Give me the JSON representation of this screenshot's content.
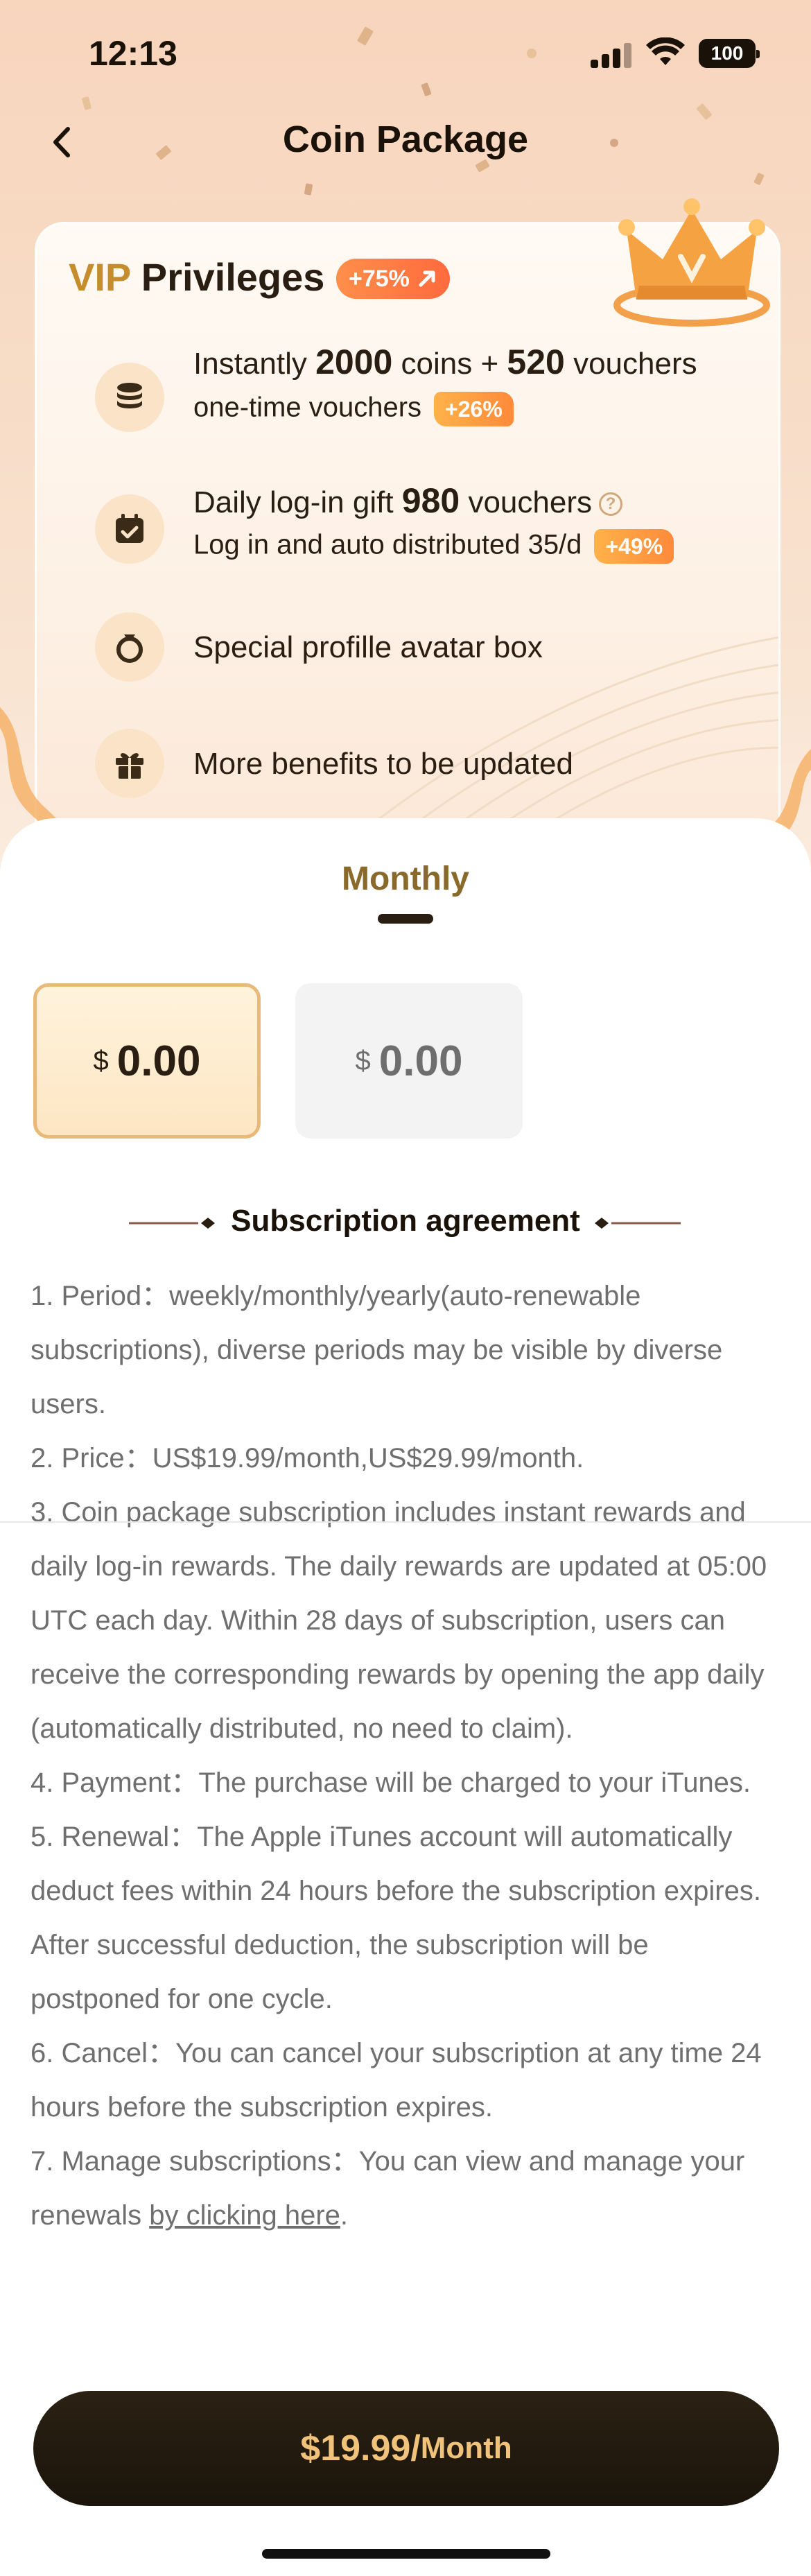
{
  "status_bar": {
    "time": "12:13",
    "battery": "100"
  },
  "header": {
    "title": "Coin Package"
  },
  "vip": {
    "title_prefix": "VIP",
    "title_rest": " Privileges",
    "badge": "+75%",
    "benefits": [
      {
        "line1_pre": "Instantly ",
        "line1_b1": "2000",
        "line1_mid": " coins + ",
        "line1_b2": "520",
        "line1_post": " vouchers",
        "line2": "one-time vouchers",
        "tag": "+26%"
      },
      {
        "line1_pre": "Daily log-in gift ",
        "line1_b1": "980",
        "line1_post": " vouchers",
        "line2": "Log in and auto distributed 35/d",
        "tag": "+49%"
      },
      {
        "line1": "Special profille avatar box"
      },
      {
        "line1": "More benefits to be updated"
      }
    ]
  },
  "period_tab": "Monthly",
  "prices": [
    {
      "currency": "$",
      "amount": "0.00",
      "selected": true
    },
    {
      "currency": "$",
      "amount": "0.00",
      "selected": false
    }
  ],
  "agreement": {
    "heading": "Subscription agreement",
    "items": [
      "1. Period：weekly/monthly/yearly(auto-renewable subscriptions), diverse periods may be visible by diverse users.",
      "2. Price：US$19.99/month,US$29.99/month.",
      "3. Coin package subscription includes instant rewards and daily log-in rewards. The daily rewards are updated at 05:00 UTC each day. Within 28 days of subscription, users can receive the corresponding rewards by opening the app daily (automatically distributed, no need to claim).",
      "4. Payment：The purchase will be charged to your iTunes.",
      "5. Renewal：The Apple iTunes account will automatically deduct fees within 24 hours before the subscription expires. After successful deduction, the subscription will be postponed for one cycle.",
      "6. Cancel：You can cancel your subscription at any time 24 hours before the subscription expires."
    ],
    "item7_pre": "7. Manage subscriptions：You can view and manage your renewals ",
    "item7_link": "by clicking here",
    "item7_post": "."
  },
  "buy_button": {
    "price": "$19.99/",
    "period": "Month"
  },
  "colors": {
    "accent_gold": "#c58d2e",
    "tag_orange": "#ff8a3a",
    "button_dark": "#1b140a",
    "button_text": "#f0c27a"
  }
}
